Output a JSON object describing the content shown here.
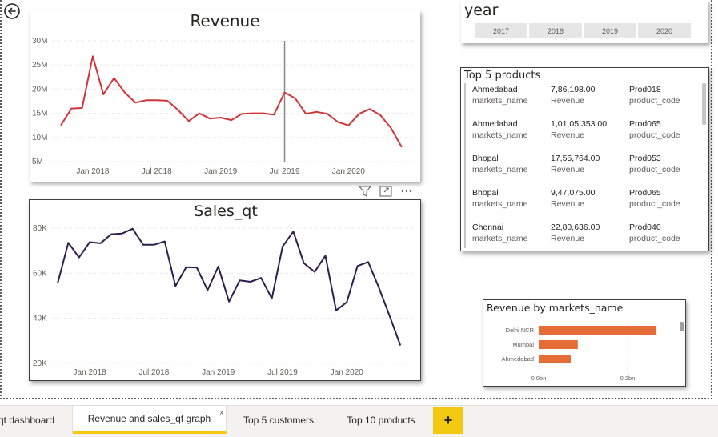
{
  "back_button": {
    "icon": "back-arrow-icon"
  },
  "revenue_chart": {
    "title": "Revenue",
    "color": "#d13438",
    "y_ticks": [
      "30M",
      "25M",
      "20M",
      "15M",
      "10M",
      "5M"
    ],
    "x_ticks": [
      "Jan 2018",
      "Jul 2018",
      "Jan 2019",
      "Jul 2019",
      "Jan 2020"
    ]
  },
  "sales_chart": {
    "title": "Sales_qt",
    "color": "#2b1f4f",
    "y_ticks": [
      "80K",
      "60K",
      "40K",
      "20K"
    ],
    "x_ticks": [
      "Jan 2018",
      "Jul 2018",
      "Jan 2019",
      "Jul 2019",
      "Jan 2020"
    ]
  },
  "visual_header": {
    "icons": [
      "filter-icon",
      "focus-mode-icon",
      "more-options-icon"
    ]
  },
  "year_slicer": {
    "title": "year",
    "options": [
      "2017",
      "2018",
      "2019",
      "2020"
    ]
  },
  "top_products": {
    "title": "Top 5 products",
    "rows": [
      {
        "market": "Ahmedabad",
        "market_label": "markets_name",
        "revenue": "7,86,198.00",
        "revenue_label": "Revenue",
        "product": "Prod018",
        "product_label": "product_code"
      },
      {
        "market": "Ahmedabad",
        "market_label": "markets_name",
        "revenue": "1,01,05,353.00",
        "revenue_label": "Revenue",
        "product": "Prod065",
        "product_label": "product_code"
      },
      {
        "market": "Bhopal",
        "market_label": "markets_name",
        "revenue": "17,55,764.00",
        "revenue_label": "Revenue",
        "product": "Prod053",
        "product_label": "product_code"
      },
      {
        "market": "Bhopal",
        "market_label": "markets_name",
        "revenue": "9,47,075.00",
        "revenue_label": "Revenue",
        "product": "Prod065",
        "product_label": "product_code"
      },
      {
        "market": "Chennai",
        "market_label": "markets_name",
        "revenue": "22,80,636.00",
        "revenue_label": "Revenue",
        "product": "Prod040",
        "product_label": "product_code"
      }
    ]
  },
  "markets_chart": {
    "title": "Revenue by markets_name",
    "x_ticks": [
      "0.0bn",
      "0.2bn"
    ],
    "bar_color": "#e66c37"
  },
  "tabs": {
    "items": [
      {
        "label": "qt dashboard"
      },
      {
        "label": "Revenue and sales_qt graph",
        "close": "x"
      },
      {
        "label": "Top 5 customers"
      },
      {
        "label": "Top 10 products"
      }
    ],
    "add_label": "+"
  },
  "chart_data": [
    {
      "type": "line",
      "title": "Revenue",
      "xlabel": "",
      "ylabel": "",
      "ylim": [
        5000000,
        30000000
      ],
      "x": [
        "2017-10",
        "2017-11",
        "2017-12",
        "2018-01",
        "2018-02",
        "2018-03",
        "2018-04",
        "2018-05",
        "2018-06",
        "2018-07",
        "2018-08",
        "2018-09",
        "2018-10",
        "2018-11",
        "2018-12",
        "2019-01",
        "2019-02",
        "2019-03",
        "2019-04",
        "2019-05",
        "2019-06",
        "2019-07",
        "2019-08",
        "2019-09",
        "2019-10",
        "2019-11",
        "2019-12",
        "2020-01",
        "2020-02",
        "2020-03",
        "2020-04",
        "2020-05",
        "2020-06"
      ],
      "series": [
        {
          "values": [
            12500000,
            16000000,
            16100000,
            26800000,
            18900000,
            22300000,
            19300000,
            17200000,
            17700000,
            17700000,
            17600000,
            15700000,
            13400000,
            15000000,
            13900000,
            14100000,
            13600000,
            14900000,
            15000000,
            15000000,
            14700000,
            19300000,
            18100000,
            14900000,
            15300000,
            14900000,
            13200000,
            12500000,
            14900000,
            15900000,
            14600000,
            11900000,
            8000000
          ]
        }
      ],
      "grid": true
    },
    {
      "type": "line",
      "title": "Sales_qt",
      "xlabel": "",
      "ylabel": "",
      "ylim": [
        20000,
        80000
      ],
      "x": [
        "2017-10",
        "2017-11",
        "2017-12",
        "2018-01",
        "2018-02",
        "2018-03",
        "2018-04",
        "2018-05",
        "2018-06",
        "2018-07",
        "2018-08",
        "2018-09",
        "2018-10",
        "2018-11",
        "2018-12",
        "2019-01",
        "2019-02",
        "2019-03",
        "2019-04",
        "2019-05",
        "2019-06",
        "2019-07",
        "2019-08",
        "2019-09",
        "2019-10",
        "2019-11",
        "2019-12",
        "2020-01",
        "2020-02",
        "2020-03",
        "2020-04",
        "2020-05",
        "2020-06"
      ],
      "series": [
        {
          "values": [
            55500,
            73500,
            67000,
            73800,
            73300,
            77300,
            77600,
            79700,
            72600,
            72600,
            74100,
            54300,
            62700,
            62500,
            52500,
            63000,
            47400,
            56800,
            56200,
            57900,
            48800,
            71800,
            78500,
            64400,
            60600,
            67800,
            43500,
            47200,
            63200,
            65000,
            53600,
            41000,
            28000
          ]
        }
      ],
      "grid": true
    },
    {
      "type": "bar",
      "orientation": "horizontal",
      "title": "Revenue by markets_name",
      "categories": [
        "Delhi NCR",
        "Mumbai",
        "Ahmedabad"
      ],
      "values": [
        0.265,
        0.088,
        0.072
      ],
      "xlim": [
        0,
        0.3
      ],
      "x_ticks": [
        "0.0bn",
        "0.2bn"
      ]
    }
  ]
}
